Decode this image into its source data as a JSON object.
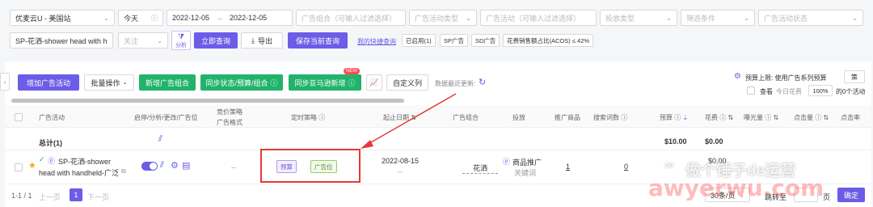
{
  "filters": {
    "store": "优麦云U - 美国站",
    "date_preset": "今天",
    "date_start": "2022-12-05",
    "date_sep": "→",
    "date_end": "2022-12-05",
    "ad_group_ph": "广告组合（可输入过滤选择）",
    "campaign_type_ph": "广告活动类型",
    "campaign_ph": "广告活动（可输入过滤选择）",
    "targeting_type_ph": "投放类型",
    "filter_cond_ph": "筛选条件",
    "campaign_status_ph": "广告活动状态",
    "keyword_value": "SP-花洒-shower head with h",
    "follow_ph": "关注",
    "analysis_label": "分析"
  },
  "actions": {
    "query": "立即查询",
    "export": "导出",
    "save_query": "保存当前查询",
    "my_quick": "我的快捷查询",
    "tags": [
      "已启用(1)",
      "SP广告",
      "SD广告",
      "花费销售额占比(ACOS) ≤ 42%"
    ]
  },
  "toolbar": {
    "add_campaign": "增加广告活动",
    "batch": "批量操作",
    "new_group": "新增广告组合",
    "sync_budget": "同步状态/预算/组合",
    "sync_amazon": "同步亚马逊新增",
    "new_badge": "NEW",
    "custom_cols": "自定义列",
    "last_update": "数据最近更新:",
    "budget_cap": "预算上限: 使用广告系列预算",
    "strategy": "策",
    "view": "查看",
    "today_spend": "今日花费",
    "pct": "100%",
    "suffix": "的0个活动"
  },
  "table": {
    "headers": {
      "campaign": "广告活动",
      "status": "启停/分析/更改/广告位",
      "bid_strategy": "竞价策略",
      "ad_format": "广告格式",
      "timing": "定时策略",
      "start_date": "起止日期",
      "ad_group": "广告组合",
      "targeting": "投放",
      "promoted": "推广商品",
      "search_terms": "搜索词数",
      "budget": "预算",
      "spend": "花费",
      "impressions": "曝光量",
      "clicks": "点击量",
      "ctr": "点击率"
    },
    "total": {
      "label": "总计(1)",
      "budget": "$10.00",
      "spend": "$0.00"
    },
    "row": {
      "name_line1": "SP-花洒-shower",
      "name_line2": "head with handheld-广泛",
      "bid": "--",
      "tag_budget": "预算",
      "tag_placement": "广告位",
      "date_start": "2022-08-15",
      "date_end": "--",
      "group": "花洒",
      "targeting_line1": "商品推广",
      "targeting_line2": "关键词",
      "promoted": "1",
      "search_terms": "0",
      "spend": "$0.00"
    }
  },
  "pagination": {
    "info": "1-1 / 1",
    "prev": "上一页",
    "page": "1",
    "next": "下一页",
    "per_page": "30条/页",
    "jump": "跳转至",
    "page_unit": "页",
    "confirm": "确定"
  },
  "watermark": {
    "line1": "做个锤子de运营",
    "line2": "awyerwu.com"
  },
  "colors": {
    "primary": "#6c5ce7",
    "green": "#21b36b",
    "highlight": "#e53935"
  }
}
